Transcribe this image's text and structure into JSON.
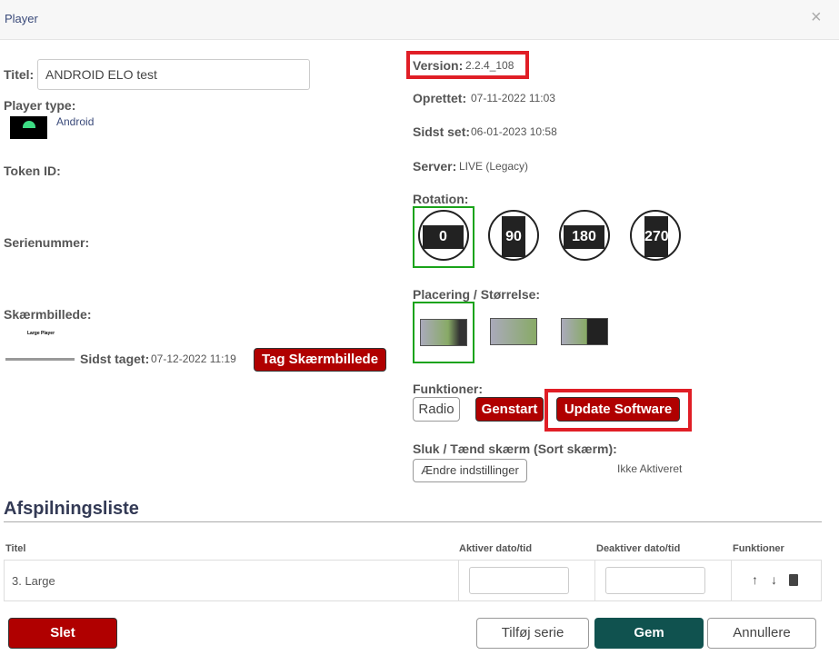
{
  "dialog": {
    "title": "Player",
    "close": "×"
  },
  "left": {
    "title_label": "Titel:",
    "title_value": "ANDROID ELO test",
    "player_type_label": "Player type:",
    "player_type_value": "Android",
    "token_label": "Token ID:",
    "serial_label": "Serienummer:",
    "screenshot_label": "Skærmbillede:",
    "screenshot_thumb_text": "Large Player",
    "last_taken_label": "Sidst taget:",
    "last_taken_value": "07-12-2022 11:19",
    "take_screenshot_button": "Tag Skærmbillede"
  },
  "right": {
    "version_label": "Version:",
    "version_value": "2.2.4_108",
    "created_label": "Oprettet:",
    "created_value": "07-11-2022 11:03",
    "last_seen_label": "Sidst set:",
    "last_seen_value": "06-01-2023 10:58",
    "server_label": "Server:",
    "server_value": "LIVE (Legacy)",
    "rotation_label": "Rotation:",
    "rotations": [
      "0",
      "90",
      "180",
      "270"
    ],
    "rotation_selected": "0",
    "placement_label": "Placering / Størrelse:",
    "functions_label": "Funktioner:",
    "radio_button": "Radio",
    "restart_button": "Genstart",
    "update_button": "Update Software",
    "screen_label": "Sluk / Tænd skærm (Sort skærm):",
    "change_settings_button": "Ændre indstillinger",
    "screen_status": "Ikke Aktiveret"
  },
  "playlist": {
    "heading": "Afspilningsliste",
    "columns": [
      "Titel",
      "Aktiver dato/tid",
      "Deaktiver dato/tid",
      "Funktioner"
    ],
    "rows": [
      {
        "title": "3. Large",
        "activate": "",
        "deactivate": ""
      }
    ]
  },
  "footer": {
    "delete": "Slet",
    "add_series": "Tilføj serie",
    "save": "Gem",
    "cancel": "Annullere"
  },
  "colors": {
    "danger": "#b00000",
    "primary": "#10524f",
    "highlight": "#e01e26",
    "selected": "#1aa31a"
  }
}
